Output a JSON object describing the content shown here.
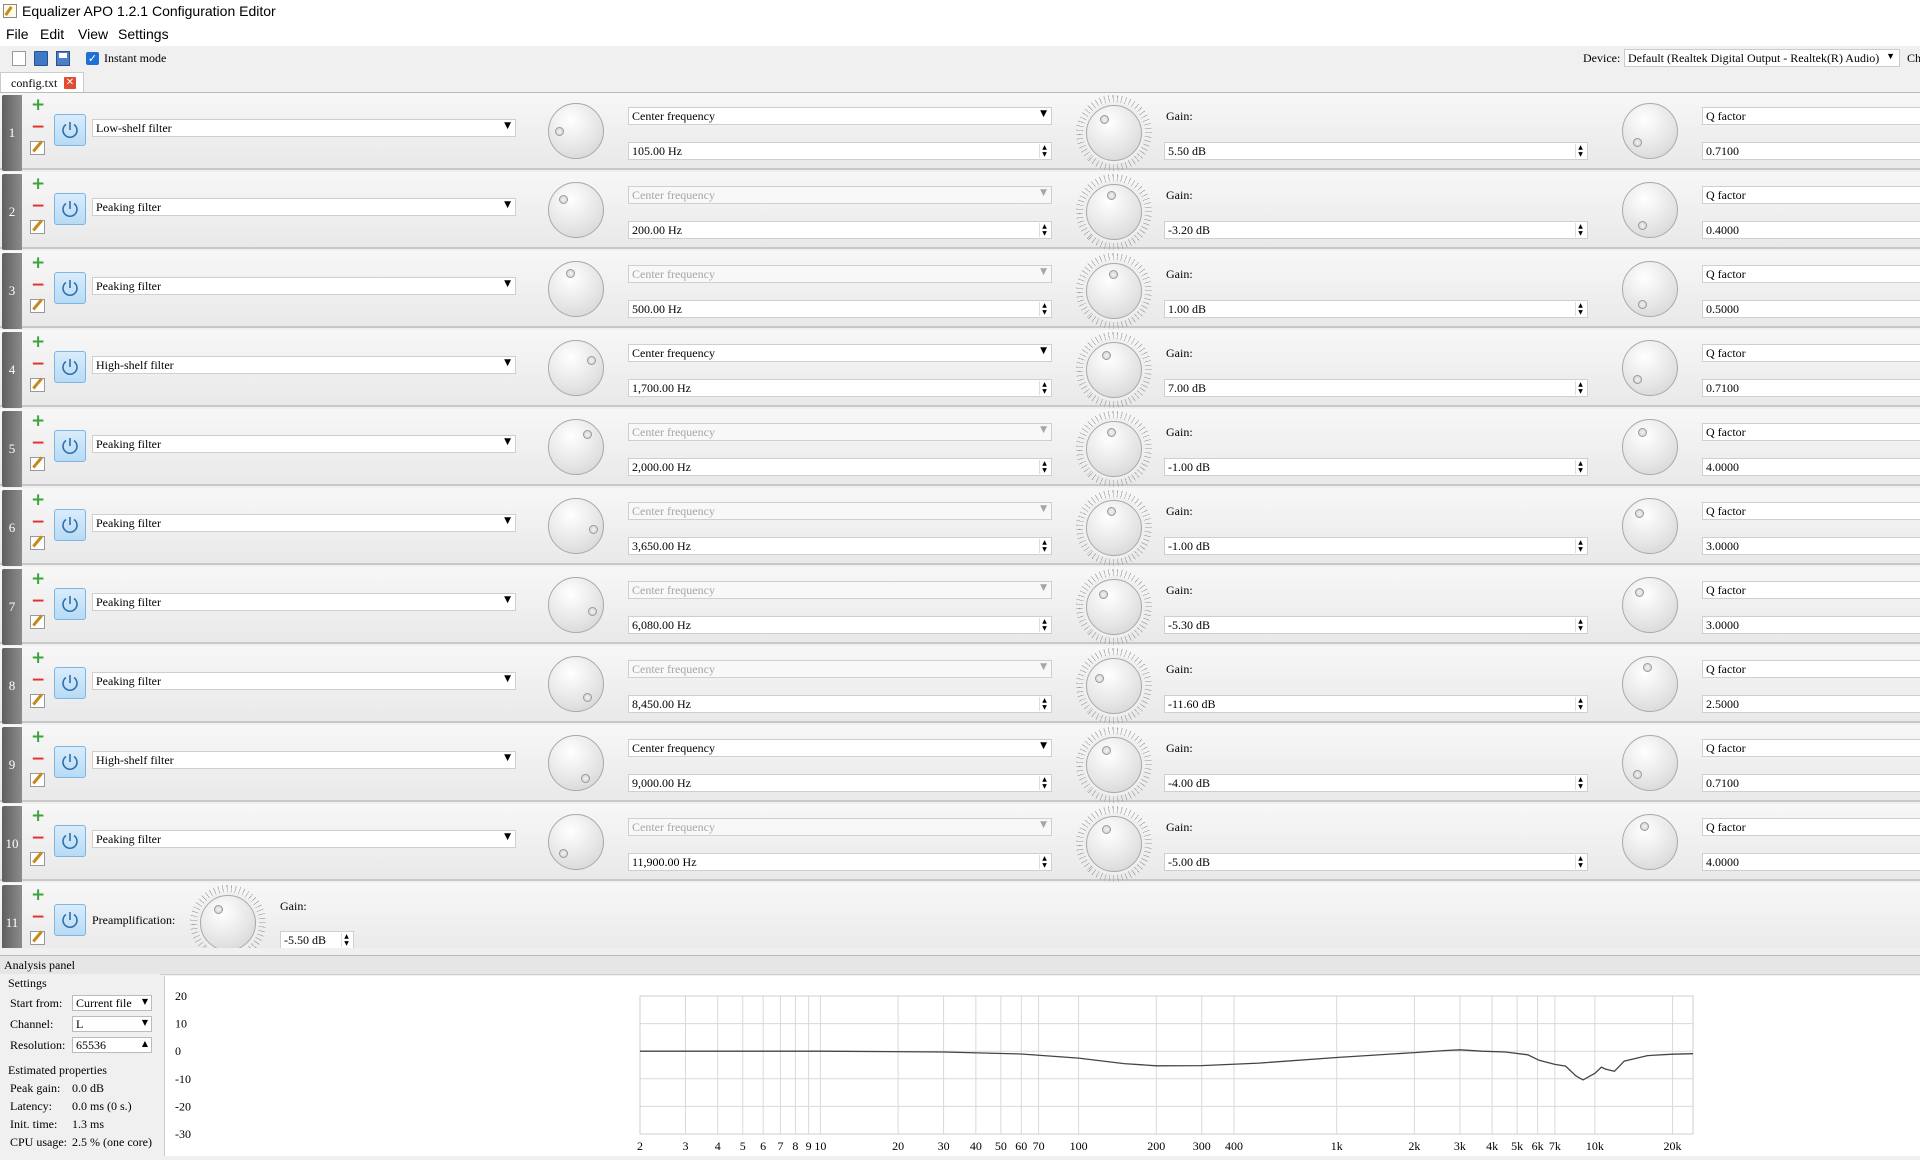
{
  "window": {
    "title": "Equalizer APO 1.2.1 Configuration Editor"
  },
  "menu": {
    "file": "File",
    "edit": "Edit",
    "view": "View",
    "settings": "Settings"
  },
  "toolbar": {
    "instant_mode_label": "Instant mode",
    "instant_mode_checked": true,
    "device_label": "Device:",
    "device_value": "Default (Realtek Digital Output - Realtek(R) Audio)",
    "clipped_label": "Ch"
  },
  "tabs": [
    {
      "label": "config.txt"
    }
  ],
  "filters": [
    {
      "num": "1",
      "type": "Low-shelf filter",
      "freq_mode": "Center frequency",
      "freq_enabled": true,
      "freq": "105.00 Hz",
      "gain_label": "Gain:",
      "gain": "5.50 dB",
      "q_label": "Q factor",
      "q": "0.7100"
    },
    {
      "num": "2",
      "type": "Peaking filter",
      "freq_mode": "Center frequency",
      "freq_enabled": false,
      "freq": "200.00 Hz",
      "gain_label": "Gain:",
      "gain": "-3.20 dB",
      "q_label": "Q factor",
      "q": "0.4000"
    },
    {
      "num": "3",
      "type": "Peaking filter",
      "freq_mode": "Center frequency",
      "freq_enabled": false,
      "freq": "500.00 Hz",
      "gain_label": "Gain:",
      "gain": "1.00 dB",
      "q_label": "Q factor",
      "q": "0.5000"
    },
    {
      "num": "4",
      "type": "High-shelf filter",
      "freq_mode": "Center frequency",
      "freq_enabled": true,
      "freq": "1,700.00 Hz",
      "gain_label": "Gain:",
      "gain": "7.00 dB",
      "q_label": "Q factor",
      "q": "0.7100"
    },
    {
      "num": "5",
      "type": "Peaking filter",
      "freq_mode": "Center frequency",
      "freq_enabled": false,
      "freq": "2,000.00 Hz",
      "gain_label": "Gain:",
      "gain": "-1.00 dB",
      "q_label": "Q factor",
      "q": "4.0000"
    },
    {
      "num": "6",
      "type": "Peaking filter",
      "freq_mode": "Center frequency",
      "freq_enabled": false,
      "freq": "3,650.00 Hz",
      "gain_label": "Gain:",
      "gain": "-1.00 dB",
      "q_label": "Q factor",
      "q": "3.0000"
    },
    {
      "num": "7",
      "type": "Peaking filter",
      "freq_mode": "Center frequency",
      "freq_enabled": false,
      "freq": "6,080.00 Hz",
      "gain_label": "Gain:",
      "gain": "-5.30 dB",
      "q_label": "Q factor",
      "q": "3.0000"
    },
    {
      "num": "8",
      "type": "Peaking filter",
      "freq_mode": "Center frequency",
      "freq_enabled": false,
      "freq": "8,450.00 Hz",
      "gain_label": "Gain:",
      "gain": "-11.60 dB",
      "q_label": "Q factor",
      "q": "2.5000"
    },
    {
      "num": "9",
      "type": "High-shelf filter",
      "freq_mode": "Center frequency",
      "freq_enabled": true,
      "freq": "9,000.00 Hz",
      "gain_label": "Gain:",
      "gain": "-4.00 dB",
      "q_label": "Q factor",
      "q": "0.7100"
    },
    {
      "num": "10",
      "type": "Peaking filter",
      "freq_mode": "Center frequency",
      "freq_enabled": false,
      "freq": "11,900.00 Hz",
      "gain_label": "Gain:",
      "gain": "-5.00 dB",
      "q_label": "Q factor",
      "q": "4.0000"
    }
  ],
  "preamp": {
    "num": "11",
    "label": "Preamplification:",
    "gain_label": "Gain:",
    "gain": "-5.50 dB"
  },
  "analysis": {
    "header": "Analysis panel",
    "settings_title": "Settings",
    "start_from_label": "Start from:",
    "start_from_value": "Current file",
    "channel_label": "Channel:",
    "channel_value": "L",
    "resolution_label": "Resolution:",
    "resolution_value": "65536",
    "estimated_title": "Estimated properties",
    "peak_gain_label": "Peak gain:",
    "peak_gain_value": "0.0 dB",
    "latency_label": "Latency:",
    "latency_value": "0.0 ms (0 s.)",
    "init_time_label": "Init. time:",
    "init_time_value": "1.3 ms",
    "cpu_label": "CPU usage:",
    "cpu_value": "2.5 % (one core)"
  },
  "chart_data": {
    "type": "line",
    "x_scale": "log",
    "xlim": [
      2,
      24000
    ],
    "ylim": [
      -30,
      20
    ],
    "y_ticks": [
      "20",
      "10",
      "0",
      "-10",
      "-20",
      "-30"
    ],
    "x_ticks": [
      {
        "v": 2,
        "t": "2"
      },
      {
        "v": 3,
        "t": "3"
      },
      {
        "v": 4,
        "t": "4"
      },
      {
        "v": 5,
        "t": "5"
      },
      {
        "v": 6,
        "t": "6"
      },
      {
        "v": 7,
        "t": "7"
      },
      {
        "v": 8,
        "t": "8"
      },
      {
        "v": 9,
        "t": "9"
      },
      {
        "v": 10,
        "t": "10"
      },
      {
        "v": 20,
        "t": "20"
      },
      {
        "v": 30,
        "t": "30"
      },
      {
        "v": 40,
        "t": "40"
      },
      {
        "v": 50,
        "t": "50"
      },
      {
        "v": 60,
        "t": "60"
      },
      {
        "v": 70,
        "t": "70"
      },
      {
        "v": 100,
        "t": "100"
      },
      {
        "v": 200,
        "t": "200"
      },
      {
        "v": 300,
        "t": "300"
      },
      {
        "v": 400,
        "t": "400"
      },
      {
        "v": 1000,
        "t": "1k"
      },
      {
        "v": 2000,
        "t": "2k"
      },
      {
        "v": 3000,
        "t": "3k"
      },
      {
        "v": 4000,
        "t": "4k"
      },
      {
        "v": 5000,
        "t": "5k"
      },
      {
        "v": 6000,
        "t": "6k"
      },
      {
        "v": 7000,
        "t": "7k"
      },
      {
        "v": 10000,
        "t": "10k"
      },
      {
        "v": 20000,
        "t": "20k"
      }
    ],
    "grid": true,
    "line_color": "#444444",
    "series": [
      {
        "x": [
          2,
          10,
          30,
          60,
          100,
          150,
          200,
          300,
          500,
          1000,
          2000,
          2600,
          3000,
          3650,
          4500,
          5500,
          6080,
          7000,
          7700,
          8450,
          9000,
          10000,
          10600,
          11000,
          11900,
          13000,
          16000,
          20000,
          24000
        ],
        "y": [
          0,
          0,
          -0.3,
          -1,
          -2.5,
          -4.5,
          -5.3,
          -5.2,
          -4.3,
          -2.3,
          -0.5,
          0.2,
          0.5,
          0,
          -0.3,
          -1.3,
          -3.3,
          -4.8,
          -5.4,
          -9,
          -10.4,
          -8,
          -5.8,
          -6.5,
          -7.3,
          -3.6,
          -1.6,
          -1.1,
          -0.9
        ]
      }
    ]
  }
}
